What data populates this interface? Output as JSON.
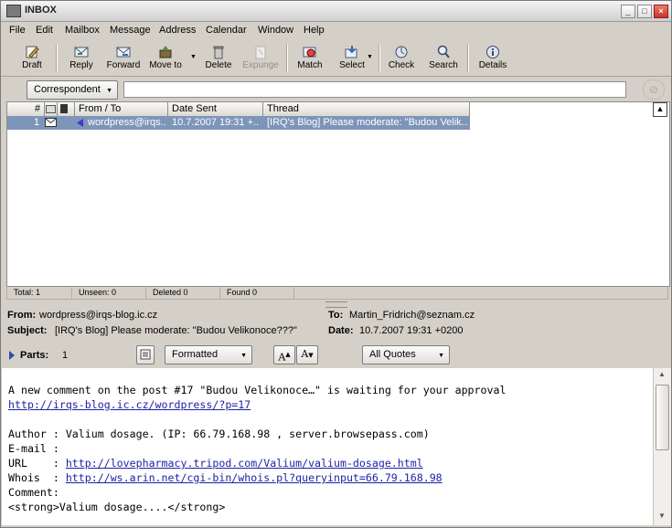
{
  "window": {
    "title": "INBOX"
  },
  "menu": [
    "File",
    "Edit",
    "Mailbox",
    "Message",
    "Address",
    "Calendar",
    "Window",
    "Help"
  ],
  "toolbar": {
    "draft": "Draft",
    "reply": "Reply",
    "forward": "Forward",
    "move_to": "Move to",
    "delete": "Delete",
    "expunge": "Expunge",
    "match": "Match",
    "select": "Select",
    "check": "Check",
    "search": "Search",
    "details": "Details"
  },
  "search": {
    "field_selector": "Correspondent",
    "query": ""
  },
  "columns": {
    "number": "#",
    "from_to": "From / To",
    "date_sent": "Date Sent",
    "thread": "Thread"
  },
  "messages": [
    {
      "number": "1",
      "from": "wordpress@irqs..",
      "date": "10.7.2007 19:31 +..",
      "thread": "[IRQ's Blog] Please moderate: \"Budou Velik..."
    }
  ],
  "status": {
    "total": "Total: 1",
    "unseen": "Unseen:  0",
    "deleted": "Deleted  0",
    "found": "Found  0"
  },
  "headers": {
    "from_label": "From:",
    "from": "wordpress@irqs-blog.ic.cz",
    "to_label": "To:",
    "to": "Martin_Fridrich@seznam.cz",
    "subject_label": "Subject:",
    "subject": "[IRQ's Blog] Please moderate: \"Budou Velikonoce???\"",
    "date_label": "Date:",
    "date": "10.7.2007 19:31 +0200"
  },
  "parts": {
    "label": "Parts:",
    "count": "1",
    "format": "Formatted",
    "quotes": "All Quotes"
  },
  "body": {
    "line1": "A new comment on the post #17 \"Budou Velikonoce…\" is waiting for your approval",
    "link1": "http://irqs-blog.ic.cz/wordpress/?p=17",
    "author": "Author : Valium dosage. (IP: 66.79.168.98 , server.browsepass.com)",
    "email": "E-mail :",
    "url_label": "URL    : ",
    "url": "http://lovepharmacy.tripod.com/Valium/valium-dosage.html",
    "whois_label": "Whois  : ",
    "whois": "http://ws.arin.net/cgi-bin/whois.pl?queryinput=66.79.168.98",
    "comment": "Comment:",
    "strong": "<strong>Valium dosage....</strong>"
  }
}
